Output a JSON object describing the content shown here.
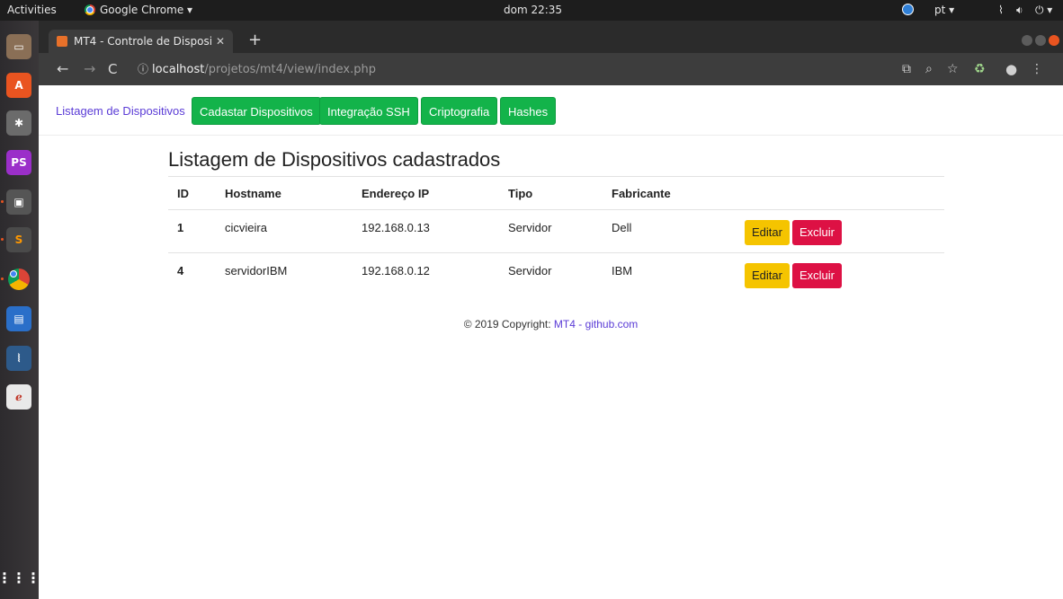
{
  "os_bar": {
    "activities": "Activities",
    "app_name": "Google Chrome ▾",
    "clock": "dom 22:35",
    "language": "pt ▾"
  },
  "browser": {
    "tab_title": "MT4 - Controle de Disposi",
    "url_host": "localhost",
    "url_path": "/projetos/mt4/view/index.php"
  },
  "nav": {
    "active_link": "Listagem de Dispositivos",
    "buttons": [
      "Cadastar Dispositivos",
      "Integração SSH",
      "Criptografia",
      "Hashes"
    ]
  },
  "main": {
    "title": "Listagem de Dispositivos cadastrados",
    "columns": [
      "ID",
      "Hostname",
      "Endereço IP",
      "Tipo",
      "Fabricante"
    ],
    "rows": [
      {
        "id": "1",
        "hostname": "cicvieira",
        "ip": "192.168.0.13",
        "tipo": "Servidor",
        "fabricante": "Dell"
      },
      {
        "id": "4",
        "hostname": "servidorIBM",
        "ip": "192.168.0.12",
        "tipo": "Servidor",
        "fabricante": "IBM"
      }
    ],
    "edit_label": "Editar",
    "delete_label": "Excluir"
  },
  "footer": {
    "text": "© 2019 Copyright: ",
    "link": "MT4 - github.com"
  },
  "colors": {
    "nav_button": "#13b34a",
    "edit_button": "#f5c400",
    "delete_button": "#dd1144",
    "link": "#5a3bd6"
  }
}
